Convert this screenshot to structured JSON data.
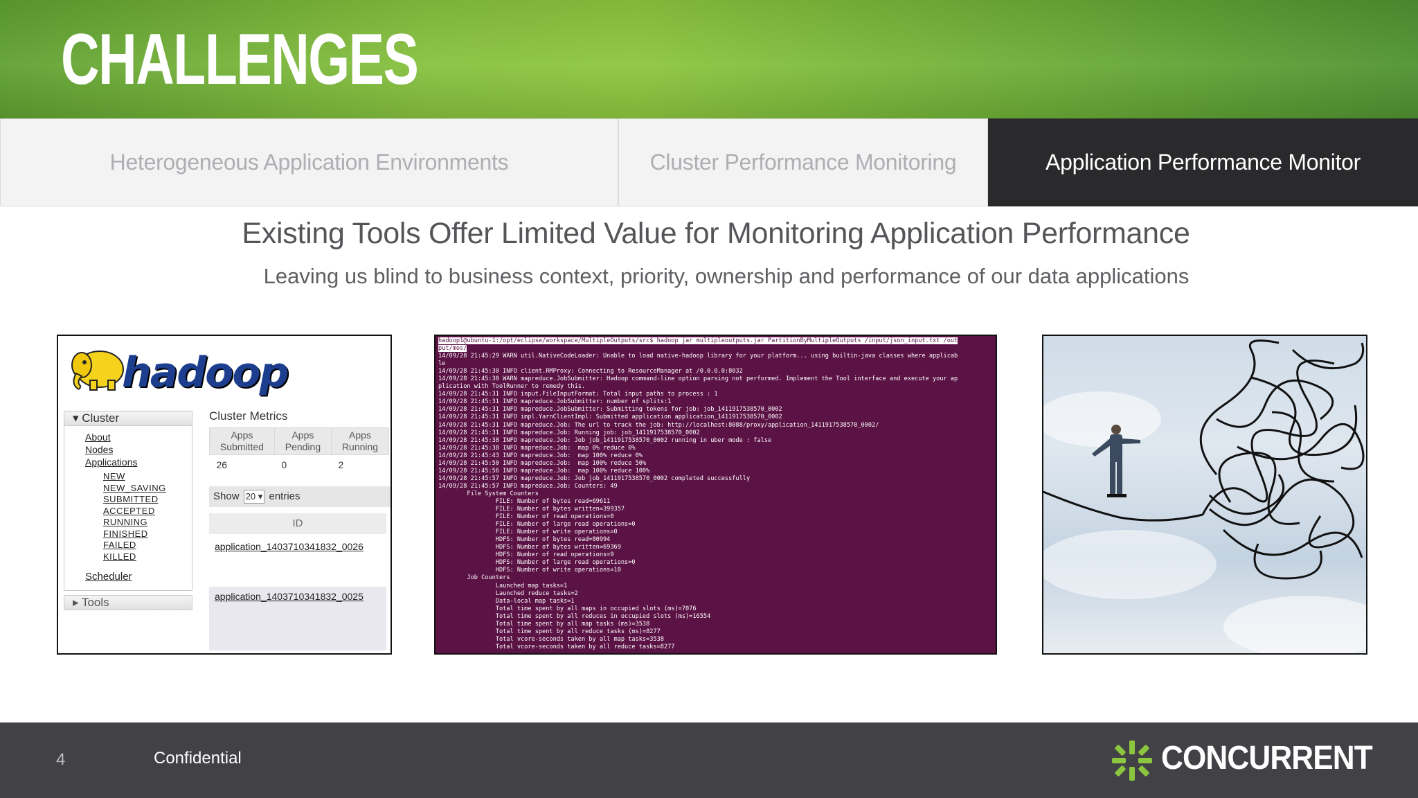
{
  "header": {
    "title": "CHALLENGES"
  },
  "tabs": [
    {
      "label": "Heterogeneous Application Environments",
      "active": false
    },
    {
      "label": "Cluster Performance Monitoring",
      "active": false
    },
    {
      "label": "Application Performance Monitor",
      "active": true
    }
  ],
  "main": {
    "headline": "Existing Tools Offer Limited Value for Monitoring Application Performance",
    "subline": "Leaving us blind to business context, priority, ownership and performance of our data applications"
  },
  "hadoop_panel": {
    "logo_text": "hadoop",
    "cluster_label": "Cluster",
    "links": [
      "About",
      "Nodes",
      "Applications"
    ],
    "sub_links": [
      "NEW",
      "NEW_SAVING",
      "SUBMITTED",
      "ACCEPTED",
      "RUNNING",
      "FINISHED",
      "FAILED",
      "KILLED"
    ],
    "scheduler": "Scheduler",
    "tools": "Tools",
    "metrics_title": "Cluster Metrics",
    "metrics_headers": [
      "Apps Submitted",
      "Apps Pending",
      "Apps Running"
    ],
    "metrics_values": [
      "26",
      "0",
      "2"
    ],
    "show_label": "Show",
    "show_value": "20",
    "entries_label": "entries",
    "id_header": "ID",
    "app_rows": [
      "application_1403710341832_0026",
      "application_1403710341832_0025"
    ]
  },
  "terminal": {
    "prompt": "hadoop1@ubuntu-1:/opt/eclipse/workspace/MultipleOutputs/src$",
    "command": " hadoop jar multipleoutputs.jar PartitionByMultipleOutputs /input/json_input.txt /out\nput/mos/",
    "lines": [
      "14/09/28 21:45:29 WARN util.NativeCodeLoader: Unable to load native-hadoop library for your platform... using builtin-java classes where applicab",
      "le",
      "14/09/28 21:45:30 INFO client.RMProxy: Connecting to ResourceManager at /0.0.0.0:8032",
      "14/09/28 21:45:30 WARN mapreduce.JobSubmitter: Hadoop command-line option parsing not performed. Implement the Tool interface and execute your ap",
      "plication with ToolRunner to remedy this.",
      "14/09/28 21:45:31 INFO input.FileInputFormat: Total input paths to process : 1",
      "14/09/28 21:45:31 INFO mapreduce.JobSubmitter: number of splits:1",
      "14/09/28 21:45:31 INFO mapreduce.JobSubmitter: Submitting tokens for job: job_1411917538570_0002",
      "14/09/28 21:45:31 INFO impl.YarnClientImpl: Submitted application application_1411917538570_0002",
      "14/09/28 21:45:31 INFO mapreduce.Job: The url to track the job: http://localhost:8088/proxy/application_1411917538570_0002/",
      "14/09/28 21:45:31 INFO mapreduce.Job: Running job: job_1411917538570_0002",
      "14/09/28 21:45:38 INFO mapreduce.Job: Job job_1411917538570_0002 running in uber mode : false",
      "14/09/28 21:45:38 INFO mapreduce.Job:  map 0% reduce 0%",
      "14/09/28 21:45:43 INFO mapreduce.Job:  map 100% reduce 0%",
      "14/09/28 21:45:50 INFO mapreduce.Job:  map 100% reduce 50%",
      "14/09/28 21:45:56 INFO mapreduce.Job:  map 100% reduce 100%",
      "14/09/28 21:45:57 INFO mapreduce.Job: Job job_1411917538570_0002 completed successfully",
      "14/09/28 21:45:57 INFO mapreduce.Job: Counters: 49",
      "        File System Counters",
      "                FILE: Number of bytes read=69611",
      "                FILE: Number of bytes written=399357",
      "                FILE: Number of read operations=0",
      "                FILE: Number of large read operations=0",
      "                FILE: Number of write operations=0",
      "                HDFS: Number of bytes read=80994",
      "                HDFS: Number of bytes written=69369",
      "                HDFS: Number of read operations=9",
      "                HDFS: Number of large read operations=0",
      "                HDFS: Number of write operations=10",
      "        Job Counters",
      "                Launched map tasks=1",
      "                Launched reduce tasks=2",
      "                Data-local map tasks=1",
      "                Total time spent by all maps in occupied slots (ms)=7076",
      "                Total time spent by all reduces in occupied slots (ms)=16554",
      "                Total time spent by all map tasks (ms)=3538",
      "                Total time spent by all reduce tasks (ms)=8277",
      "                Total vcore-seconds taken by all map tasks=3538",
      "                Total vcore-seconds taken by all reduce tasks=8277"
    ]
  },
  "footer": {
    "page_number": "4",
    "confidential": "Confidential",
    "brand": "CONCURRENT"
  },
  "colors": {
    "header_green": "#8cc63f",
    "active_tab": "#2a2a2c",
    "terminal_bg": "#5b1245",
    "footer_bg": "#424145"
  }
}
